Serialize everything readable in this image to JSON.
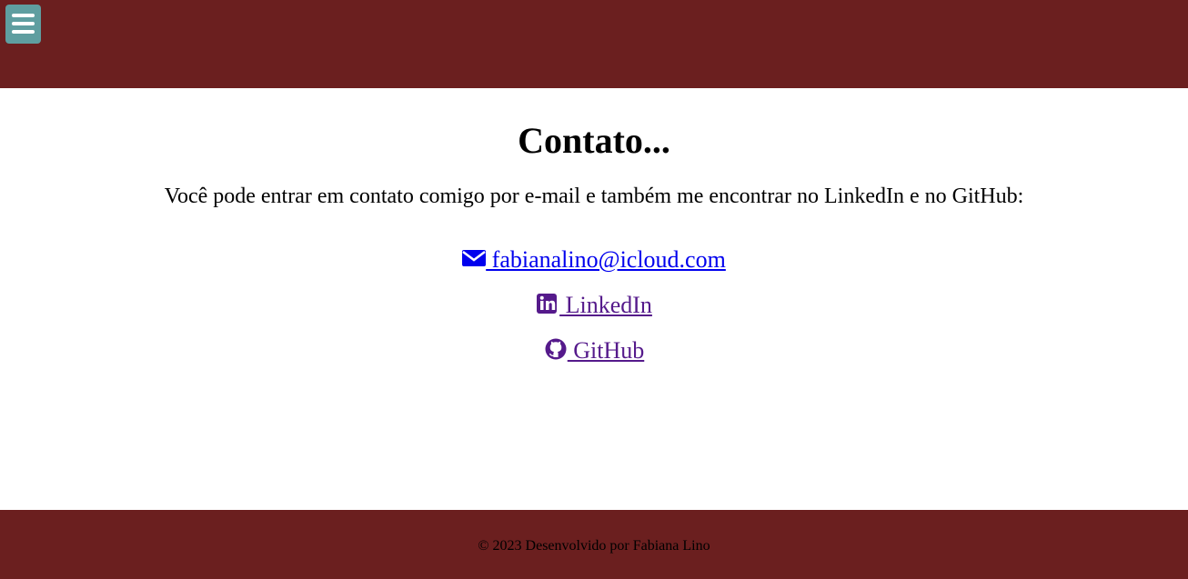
{
  "header": {
    "menu_icon": "hamburger-menu-icon",
    "background_color": "#6b1f1f",
    "menu_button_color": "#5f9ea0"
  },
  "main": {
    "title": "Contato...",
    "intro": "Você pode entrar em contato comigo por e-mail e também me encontrar no LinkedIn e no GitHub:",
    "links": [
      {
        "icon": "envelope-icon",
        "label": " fabianalino@icloud.com",
        "color": "#0000ee"
      },
      {
        "icon": "linkedin-icon",
        "label": " LinkedIn",
        "color": "#551a8b"
      },
      {
        "icon": "github-icon",
        "label": " GitHub",
        "color": "#551a8b"
      }
    ]
  },
  "footer": {
    "text": "© 2023 Desenvolvido por Fabiana Lino",
    "background_color": "#6b1f1f"
  }
}
